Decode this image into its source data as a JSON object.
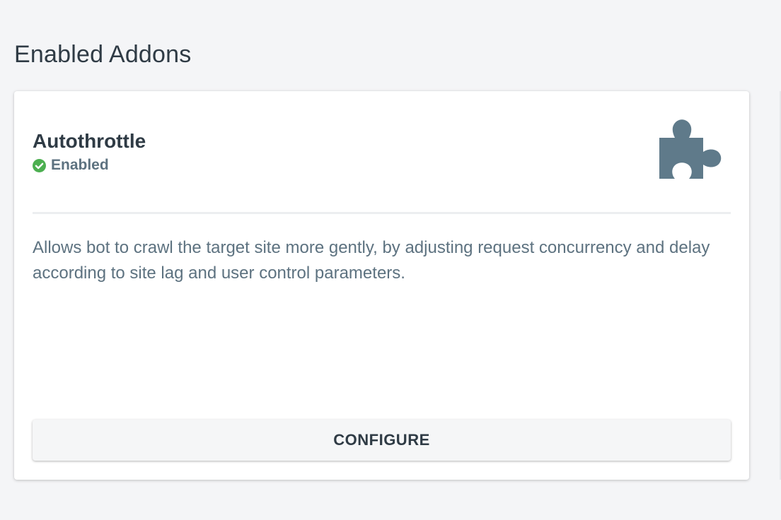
{
  "section": {
    "title": "Enabled Addons"
  },
  "addon": {
    "name": "Autothrottle",
    "status_label": "Enabled",
    "status_icon": "check-circle-icon",
    "addon_icon": "puzzle-piece-icon",
    "description": "Allows bot to crawl the target site more gently, by adjusting request concurrency and delay according to site lag and user control parameters.",
    "configure_label": "CONFIGURE"
  },
  "colors": {
    "background": "#f4f5f7",
    "card": "#ffffff",
    "heading_text": "#2f3b45",
    "muted_text": "#5d7280",
    "status_green": "#4caf50",
    "puzzle_icon": "#5f7a8a"
  }
}
